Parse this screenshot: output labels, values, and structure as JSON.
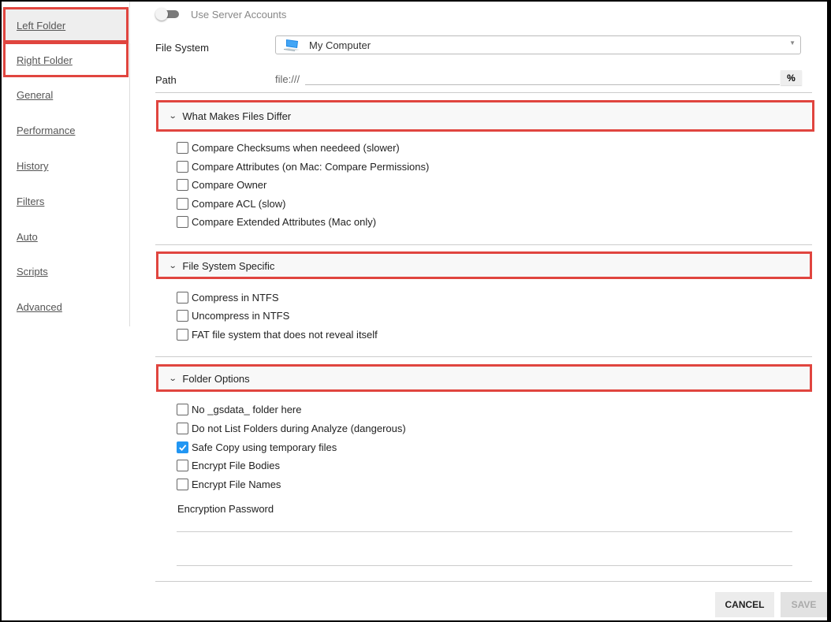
{
  "sidebar": {
    "items": [
      {
        "label": "Left Folder",
        "active": true
      },
      {
        "label": "Right Folder"
      },
      {
        "label": "General"
      },
      {
        "label": "Performance"
      },
      {
        "label": "History"
      },
      {
        "label": "Filters"
      },
      {
        "label": "Auto"
      },
      {
        "label": "Scripts"
      },
      {
        "label": "Advanced"
      }
    ]
  },
  "server_accounts": {
    "label": "Use Server Accounts",
    "enabled": false
  },
  "file_system": {
    "label": "File System",
    "value": "My Computer",
    "icon": "computer-icon"
  },
  "path": {
    "label": "Path",
    "prefix": "file:///",
    "value": "",
    "button_label": "%"
  },
  "sections": [
    {
      "title": "What Makes Files Differ",
      "options": [
        {
          "label": "Compare Checksums when needeed (slower)",
          "checked": false
        },
        {
          "label": "Compare Attributes (on Mac: Compare Permissions)",
          "checked": false
        },
        {
          "label": "Compare Owner",
          "checked": false
        },
        {
          "label": "Compare ACL (slow)",
          "checked": false
        },
        {
          "label": "Compare Extended Attributes (Mac only)",
          "checked": false
        }
      ]
    },
    {
      "title": "File System Specific",
      "options": [
        {
          "label": "Compress in NTFS",
          "checked": false
        },
        {
          "label": "Uncompress in NTFS",
          "checked": false
        },
        {
          "label": "FAT file system that does not reveal itself",
          "checked": false
        }
      ]
    },
    {
      "title": "Folder Options",
      "options": [
        {
          "label": "No _gsdata_ folder here",
          "checked": false
        },
        {
          "label": "Do not List Folders during Analyze (dangerous)",
          "checked": false
        },
        {
          "label": "Safe Copy using temporary files",
          "checked": true
        },
        {
          "label": "Encrypt File Bodies",
          "checked": false
        },
        {
          "label": "Encrypt File Names",
          "checked": false
        }
      ]
    }
  ],
  "encryption": {
    "label": "Encryption Password",
    "value": "",
    "confirm_value": ""
  },
  "buttons": {
    "cancel": "CANCEL",
    "save": "SAVE"
  },
  "colors": {
    "highlight": "#e0453f",
    "checkbox_checked": "#2196f3"
  }
}
